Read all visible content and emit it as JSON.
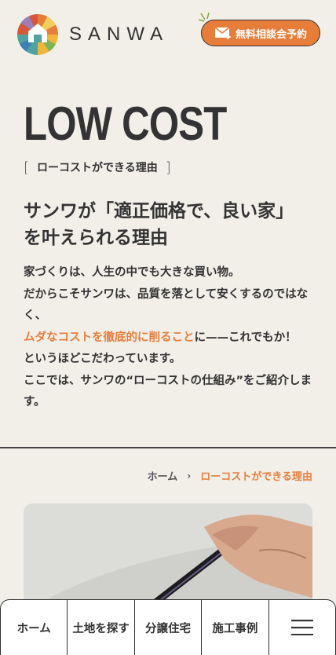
{
  "header": {
    "brand": "SANWA",
    "cta_label": "無料相談会予約",
    "logo_icon": "sanwa-logo",
    "mail_icon": "mail-icon",
    "colors": {
      "accent": "#e67e3a",
      "background": "#f2efe9"
    }
  },
  "hero": {
    "title": "LOW COST",
    "subtitle": "ローコストができる理由",
    "bracket_open": "[",
    "bracket_close": "]",
    "heading_line1": "サンワが「適正価格で、良い家」",
    "heading_line2": "を叶えられる理由",
    "body": {
      "line1": "家づくりは、人生の中でも大きな買い物。",
      "line2": "だからこそサンワは、品質を落として安くするのではなく、",
      "highlight": "ムダなコストを徹底的に削ること",
      "line3_rest": "に——これでもか！",
      "line4": "というほどこだわっています。",
      "line5": "ここでは、サンワの“ローコストの仕組み”をご紹介します。"
    }
  },
  "breadcrumb": {
    "home": "ホーム",
    "separator": "›",
    "current": "ローコストができる理由"
  },
  "bottom_nav": {
    "items": [
      "ホーム",
      "土地を探す",
      "分譲住宅",
      "施工事例"
    ],
    "menu_icon": "hamburger-menu-icon"
  }
}
